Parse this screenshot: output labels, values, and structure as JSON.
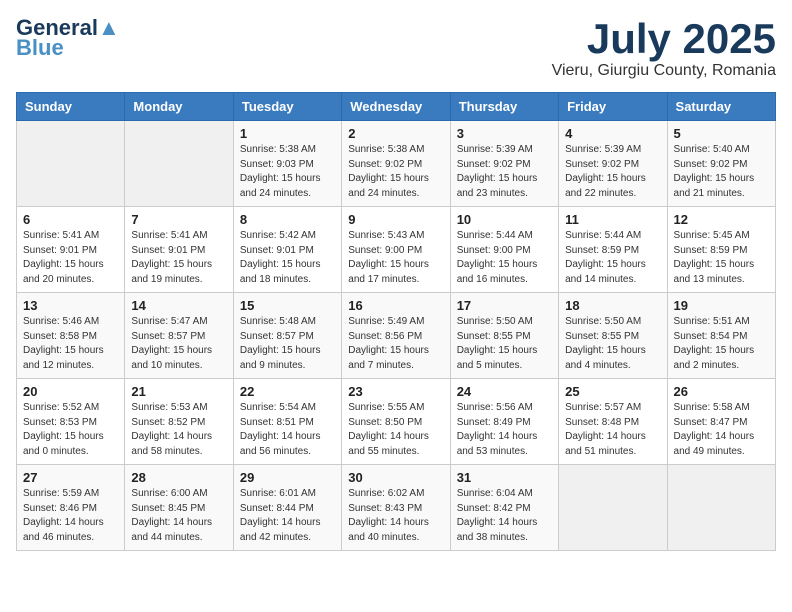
{
  "logo": {
    "line1": "General",
    "line2": "Blue"
  },
  "title": "July 2025",
  "location": "Vieru, Giurgiu County, Romania",
  "days_of_week": [
    "Sunday",
    "Monday",
    "Tuesday",
    "Wednesday",
    "Thursday",
    "Friday",
    "Saturday"
  ],
  "weeks": [
    [
      {
        "day": "",
        "info": ""
      },
      {
        "day": "",
        "info": ""
      },
      {
        "day": "1",
        "info": "Sunrise: 5:38 AM\nSunset: 9:03 PM\nDaylight: 15 hours\nand 24 minutes."
      },
      {
        "day": "2",
        "info": "Sunrise: 5:38 AM\nSunset: 9:02 PM\nDaylight: 15 hours\nand 24 minutes."
      },
      {
        "day": "3",
        "info": "Sunrise: 5:39 AM\nSunset: 9:02 PM\nDaylight: 15 hours\nand 23 minutes."
      },
      {
        "day": "4",
        "info": "Sunrise: 5:39 AM\nSunset: 9:02 PM\nDaylight: 15 hours\nand 22 minutes."
      },
      {
        "day": "5",
        "info": "Sunrise: 5:40 AM\nSunset: 9:02 PM\nDaylight: 15 hours\nand 21 minutes."
      }
    ],
    [
      {
        "day": "6",
        "info": "Sunrise: 5:41 AM\nSunset: 9:01 PM\nDaylight: 15 hours\nand 20 minutes."
      },
      {
        "day": "7",
        "info": "Sunrise: 5:41 AM\nSunset: 9:01 PM\nDaylight: 15 hours\nand 19 minutes."
      },
      {
        "day": "8",
        "info": "Sunrise: 5:42 AM\nSunset: 9:01 PM\nDaylight: 15 hours\nand 18 minutes."
      },
      {
        "day": "9",
        "info": "Sunrise: 5:43 AM\nSunset: 9:00 PM\nDaylight: 15 hours\nand 17 minutes."
      },
      {
        "day": "10",
        "info": "Sunrise: 5:44 AM\nSunset: 9:00 PM\nDaylight: 15 hours\nand 16 minutes."
      },
      {
        "day": "11",
        "info": "Sunrise: 5:44 AM\nSunset: 8:59 PM\nDaylight: 15 hours\nand 14 minutes."
      },
      {
        "day": "12",
        "info": "Sunrise: 5:45 AM\nSunset: 8:59 PM\nDaylight: 15 hours\nand 13 minutes."
      }
    ],
    [
      {
        "day": "13",
        "info": "Sunrise: 5:46 AM\nSunset: 8:58 PM\nDaylight: 15 hours\nand 12 minutes."
      },
      {
        "day": "14",
        "info": "Sunrise: 5:47 AM\nSunset: 8:57 PM\nDaylight: 15 hours\nand 10 minutes."
      },
      {
        "day": "15",
        "info": "Sunrise: 5:48 AM\nSunset: 8:57 PM\nDaylight: 15 hours\nand 9 minutes."
      },
      {
        "day": "16",
        "info": "Sunrise: 5:49 AM\nSunset: 8:56 PM\nDaylight: 15 hours\nand 7 minutes."
      },
      {
        "day": "17",
        "info": "Sunrise: 5:50 AM\nSunset: 8:55 PM\nDaylight: 15 hours\nand 5 minutes."
      },
      {
        "day": "18",
        "info": "Sunrise: 5:50 AM\nSunset: 8:55 PM\nDaylight: 15 hours\nand 4 minutes."
      },
      {
        "day": "19",
        "info": "Sunrise: 5:51 AM\nSunset: 8:54 PM\nDaylight: 15 hours\nand 2 minutes."
      }
    ],
    [
      {
        "day": "20",
        "info": "Sunrise: 5:52 AM\nSunset: 8:53 PM\nDaylight: 15 hours\nand 0 minutes."
      },
      {
        "day": "21",
        "info": "Sunrise: 5:53 AM\nSunset: 8:52 PM\nDaylight: 14 hours\nand 58 minutes."
      },
      {
        "day": "22",
        "info": "Sunrise: 5:54 AM\nSunset: 8:51 PM\nDaylight: 14 hours\nand 56 minutes."
      },
      {
        "day": "23",
        "info": "Sunrise: 5:55 AM\nSunset: 8:50 PM\nDaylight: 14 hours\nand 55 minutes."
      },
      {
        "day": "24",
        "info": "Sunrise: 5:56 AM\nSunset: 8:49 PM\nDaylight: 14 hours\nand 53 minutes."
      },
      {
        "day": "25",
        "info": "Sunrise: 5:57 AM\nSunset: 8:48 PM\nDaylight: 14 hours\nand 51 minutes."
      },
      {
        "day": "26",
        "info": "Sunrise: 5:58 AM\nSunset: 8:47 PM\nDaylight: 14 hours\nand 49 minutes."
      }
    ],
    [
      {
        "day": "27",
        "info": "Sunrise: 5:59 AM\nSunset: 8:46 PM\nDaylight: 14 hours\nand 46 minutes."
      },
      {
        "day": "28",
        "info": "Sunrise: 6:00 AM\nSunset: 8:45 PM\nDaylight: 14 hours\nand 44 minutes."
      },
      {
        "day": "29",
        "info": "Sunrise: 6:01 AM\nSunset: 8:44 PM\nDaylight: 14 hours\nand 42 minutes."
      },
      {
        "day": "30",
        "info": "Sunrise: 6:02 AM\nSunset: 8:43 PM\nDaylight: 14 hours\nand 40 minutes."
      },
      {
        "day": "31",
        "info": "Sunrise: 6:04 AM\nSunset: 8:42 PM\nDaylight: 14 hours\nand 38 minutes."
      },
      {
        "day": "",
        "info": ""
      },
      {
        "day": "",
        "info": ""
      }
    ]
  ]
}
